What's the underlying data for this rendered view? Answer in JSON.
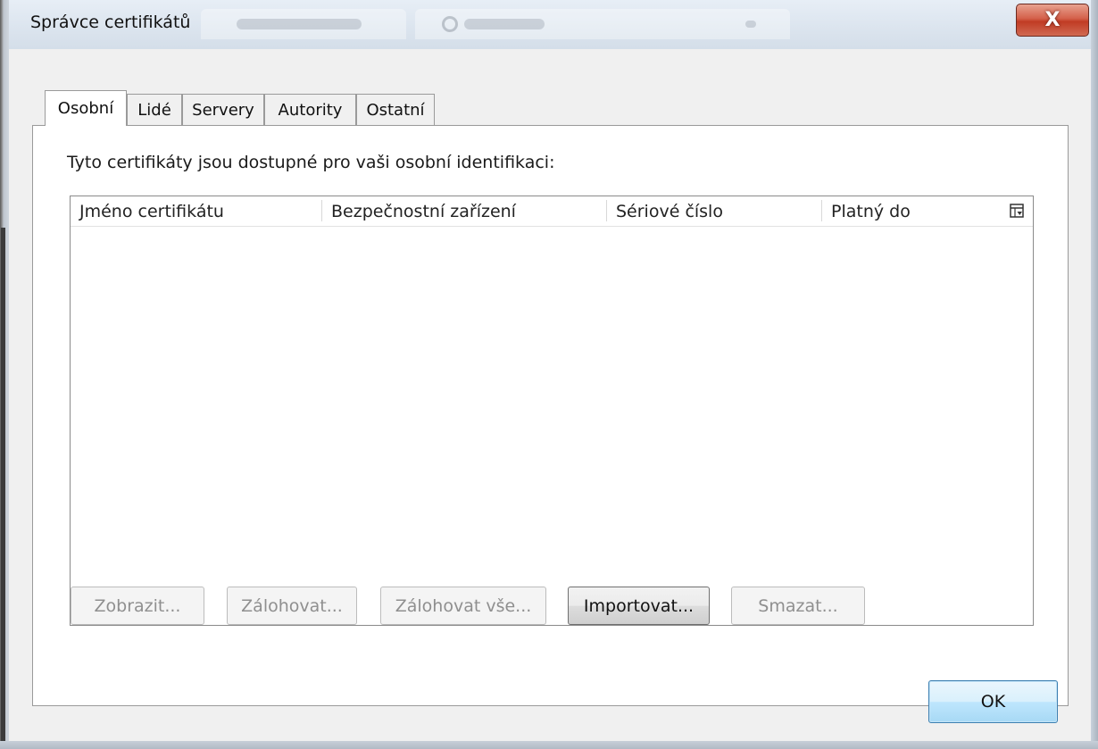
{
  "window": {
    "title": "Správce certifikátů",
    "close_label": "X"
  },
  "tabs": [
    {
      "label": "Osobní",
      "active": true
    },
    {
      "label": "Lidé",
      "active": false
    },
    {
      "label": "Servery",
      "active": false
    },
    {
      "label": "Autority",
      "active": false
    },
    {
      "label": "Ostatní",
      "active": false
    }
  ],
  "panel": {
    "description": "Tyto certifikáty jsou dostupné pro vaši osobní identifikaci:"
  },
  "table": {
    "columns": [
      "Jméno certifikátu",
      "Bezpečnostní zařízení",
      "Sériové číslo",
      "Platný do"
    ],
    "rows": [],
    "column_picker_icon": "column-picker-icon"
  },
  "actions": {
    "view": {
      "label": "Zobrazit...",
      "enabled": false
    },
    "backup": {
      "label": "Zálohovat...",
      "enabled": false
    },
    "backup_all": {
      "label": "Zálohovat vše...",
      "enabled": false
    },
    "import": {
      "label": "Importovat...",
      "enabled": true
    },
    "delete": {
      "label": "Smazat...",
      "enabled": false
    }
  },
  "footer": {
    "ok_label": "OK"
  },
  "colors": {
    "close_button": "#c13b24",
    "ok_border": "#3c7fb1",
    "disabled_text": "#8f8f8f"
  }
}
